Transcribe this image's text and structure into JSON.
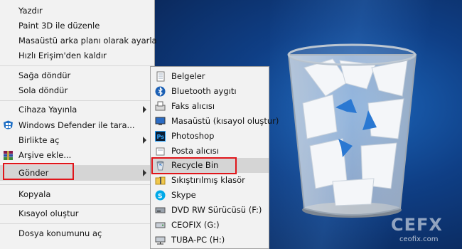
{
  "context_menu": {
    "items": [
      {
        "label": "Yazdır"
      },
      {
        "label": "Paint 3D ile düzenle"
      },
      {
        "label": "Masaüstü arka planı olarak ayarla"
      },
      {
        "label": "Hızlı Erişim'den kaldır"
      },
      {
        "label": "Sağa döndür"
      },
      {
        "label": "Sola döndür"
      },
      {
        "label": "Cihaza Yayınla"
      },
      {
        "label": "Windows Defender ile tara..."
      },
      {
        "label": "Birlikte aç"
      },
      {
        "label": "Arşive ekle..."
      },
      {
        "label": "Gönder"
      },
      {
        "label": "Kopyala"
      },
      {
        "label": "Kısayol oluştur"
      },
      {
        "label": "Dosya konumunu aç"
      }
    ]
  },
  "send_to_menu": {
    "items": [
      {
        "label": "Belgeler",
        "icon": "documents-icon"
      },
      {
        "label": "Bluetooth aygıtı",
        "icon": "bluetooth-icon"
      },
      {
        "label": "Faks alıcısı",
        "icon": "fax-icon"
      },
      {
        "label": "Masaüstü (kısayol oluştur)",
        "icon": "desktop-icon"
      },
      {
        "label": "Photoshop",
        "icon": "photoshop-icon"
      },
      {
        "label": "Posta alıcısı",
        "icon": "mail-icon"
      },
      {
        "label": "Recycle Bin",
        "icon": "recycle-bin-icon"
      },
      {
        "label": "Sıkıştırılmış klasör",
        "icon": "zip-folder-icon"
      },
      {
        "label": "Skype",
        "icon": "skype-icon"
      },
      {
        "label": "DVD RW Sürücüsü (F:)",
        "icon": "dvd-drive-icon"
      },
      {
        "label": "CEOFIX (G:)",
        "icon": "drive-icon"
      },
      {
        "label": "TUBA-PC (H:)",
        "icon": "network-drive-icon"
      }
    ]
  },
  "watermark": {
    "logo": "CEFX",
    "url": "ceofix.com"
  },
  "colors": {
    "highlight_border": "#e0161b",
    "menu_bg": "#f2f2f2",
    "desktop": "#0f3f86"
  }
}
